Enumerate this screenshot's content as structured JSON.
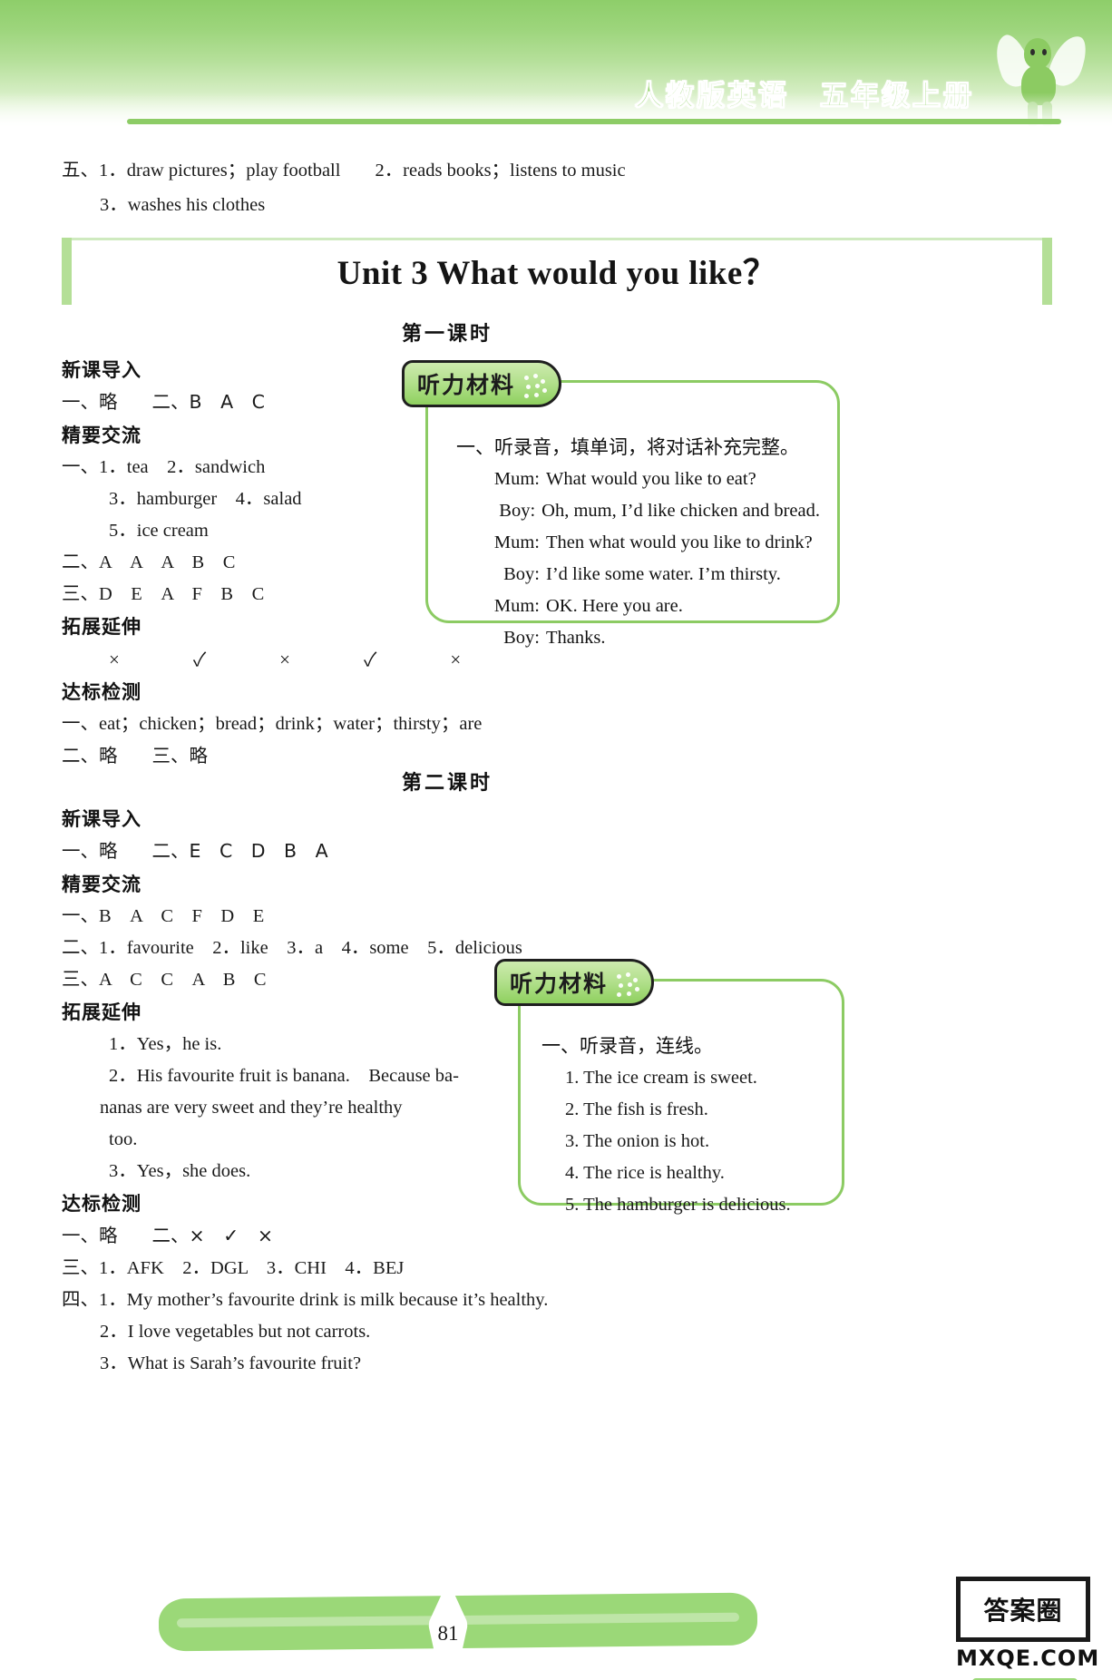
{
  "header": {
    "book_title_part1": "人教版英语",
    "book_title_part2": "五年级上册",
    "mascot": "fairy-sprite"
  },
  "top_answers": {
    "line1": "五、1．draw pictures；play football　2．reads books；listens to music",
    "line1_label": "五、",
    "line1_item1": "1．draw pictures；play football",
    "line1_item2": "2．reads books；listens to music",
    "line2": "3．washes his clothes"
  },
  "unit": {
    "title": "Unit 3 What would you like？"
  },
  "lesson1": {
    "heading": "第一课时",
    "left": {
      "sec1_head": "新课导入",
      "sec1_r1_a": "一、略",
      "sec1_r1_b": "二、B　A　C",
      "sec2_head": "精要交流",
      "sec2_r1": "一、1．tea　2．sandwich",
      "sec2_r2": "3．hamburger　4．salad",
      "sec2_r3": "5．ice cream",
      "sec2_r4": "二、A　A　A　B　C",
      "sec2_r5": "三、D　E　A　F　B　C",
      "sec3_head": "拓展延伸",
      "sec3_marks": "×　✓　×　✓　×",
      "sec4_head": "达标检测",
      "sec4_r1": "一、eat；chicken；bread；drink；water；thirsty；are",
      "sec4_r2_a": "二、略",
      "sec4_r2_b": "三、略"
    },
    "listening": {
      "tab_label": "听力材料",
      "task_title": "一、听录音，填单词，将对话补充完整。",
      "dialogue": [
        {
          "speaker": "Mum:",
          "text": "What would you like to eat?"
        },
        {
          "speaker": "Boy:",
          "text": "Oh, mum, I’d like chicken and bread."
        },
        {
          "speaker": "Mum:",
          "text": "Then what would you like to drink?"
        },
        {
          "speaker": "Boy:",
          "text": "I’d like some water. I’m thirsty."
        },
        {
          "speaker": "Mum:",
          "text": "OK. Here you are."
        },
        {
          "speaker": "Boy:",
          "text": "Thanks."
        }
      ]
    }
  },
  "lesson2": {
    "heading": "第二课时",
    "left": {
      "sec1_head": "新课导入",
      "sec1_r1_a": "一、略",
      "sec1_r1_b": "二、E　C　D　B　A",
      "sec2_head": "精要交流",
      "sec2_r1": "一、B　A　C　F　D　E",
      "sec2_r2": "二、1．favourite　2．like　3．a　4．some　5．delicious",
      "sec2_r3": "三、A　C　C　A　B　C",
      "sec3_head": "拓展延伸",
      "sec3_r1": "1．Yes，he is.",
      "sec3_r2_l1": "2．His favourite fruit is banana.　Because ba-",
      "sec3_r2_l2": "nanas are very sweet and they’re healthy",
      "sec3_r2_l3": "too.",
      "sec3_r3": "3．Yes，she does.",
      "sec4_head": "达标检测",
      "sec4_r1_a": "一、略",
      "sec4_r1_b": "二、×　✓　×",
      "sec4_r2": "三、1．AFK　2．DGL　3．CHI　4．BEJ",
      "sec4_r3_1": "四、1．My mother’s favourite drink is milk because it’s healthy.",
      "sec4_r3_2": "2．I love vegetables but not carrots.",
      "sec4_r3_3": "3．What is Sarah’s favourite fruit?"
    },
    "listening": {
      "tab_label": "听力材料",
      "task_title": "一、听录音，连线。",
      "items": [
        "1. The ice cream is sweet.",
        "2. The fish is fresh.",
        "3. The onion is hot.",
        "4. The rice is healthy.",
        "5. The hamburger is delicious."
      ]
    }
  },
  "footer": {
    "page_number": "81",
    "watermark_main": "答案圈",
    "watermark_sub": "MXQE.COM"
  },
  "colors": {
    "brand_green": "#8ccb63",
    "band_green": "#9bd878",
    "tab_dark": "#1f1f1f",
    "text": "#1a1a1a"
  }
}
